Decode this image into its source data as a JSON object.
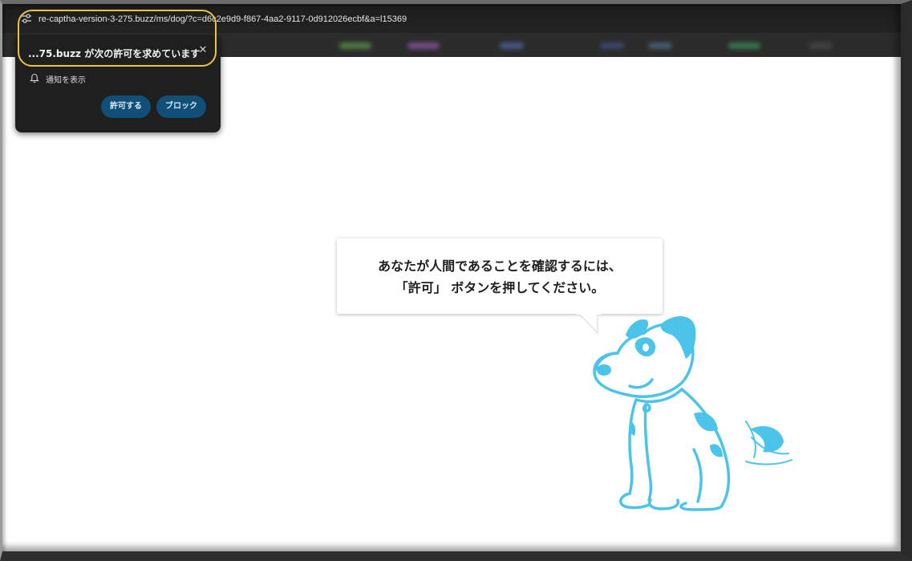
{
  "browser": {
    "url": "re-captha-version-3-275.buzz/ms/dog/?c=d6c2e9d9-f867-4aa2-9117-0d912026ecbf&a=l15369"
  },
  "permission_popup": {
    "title": "...75.buzz が次の許可を求めています",
    "permission": "通知を表示",
    "allow_label": "許可する",
    "block_label": "ブロック",
    "close_glyph": "✕"
  },
  "message": {
    "line1": "あなたが人間であることを確認するには、",
    "line2": "「許可」 ボタンを押してください。"
  },
  "colors": {
    "popup_background": "#1f1f1f",
    "popup_button": "#0f4f78",
    "highlight": "#f0c040",
    "dog": "#4cc3e8"
  },
  "icons": {
    "site_info": "tune-icon",
    "bell": "bell-icon",
    "close": "close-icon",
    "mascot": "dog-illustration"
  }
}
